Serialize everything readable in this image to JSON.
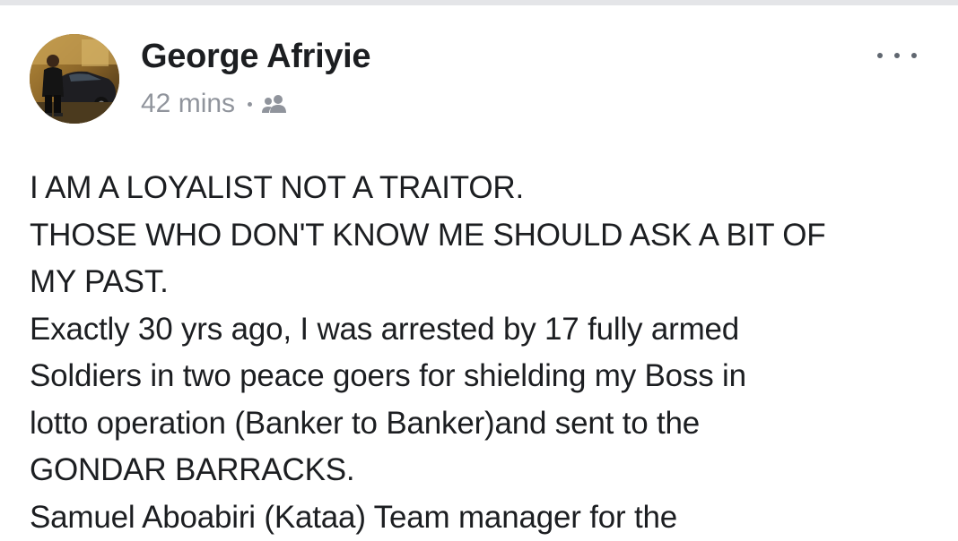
{
  "post": {
    "author": {
      "name": "George Afriyie",
      "avatar_icon": "avatar-photo"
    },
    "meta": {
      "time": "42 mins",
      "audience_icon": "friends-icon"
    },
    "menu_icon": "more-options-icon",
    "body_lines": [
      "I AM A LOYALIST NOT A TRAITOR.",
      "THOSE WHO DON'T KNOW ME SHOULD ASK A BIT OF",
      "MY PAST.",
      "Exactly 30 yrs ago, I was arrested by 17 fully armed",
      "Soldiers in two peace goers for shielding my Boss in",
      "lotto operation (Banker to Banker)and sent to the",
      "GONDAR BARRACKS.",
      "Samuel Aboabiri (Kataa) Team manager for the"
    ]
  },
  "colors": {
    "text_primary": "#1c1e21",
    "text_secondary": "#90949c",
    "background": "#ffffff",
    "divider": "#e4e5e8"
  }
}
